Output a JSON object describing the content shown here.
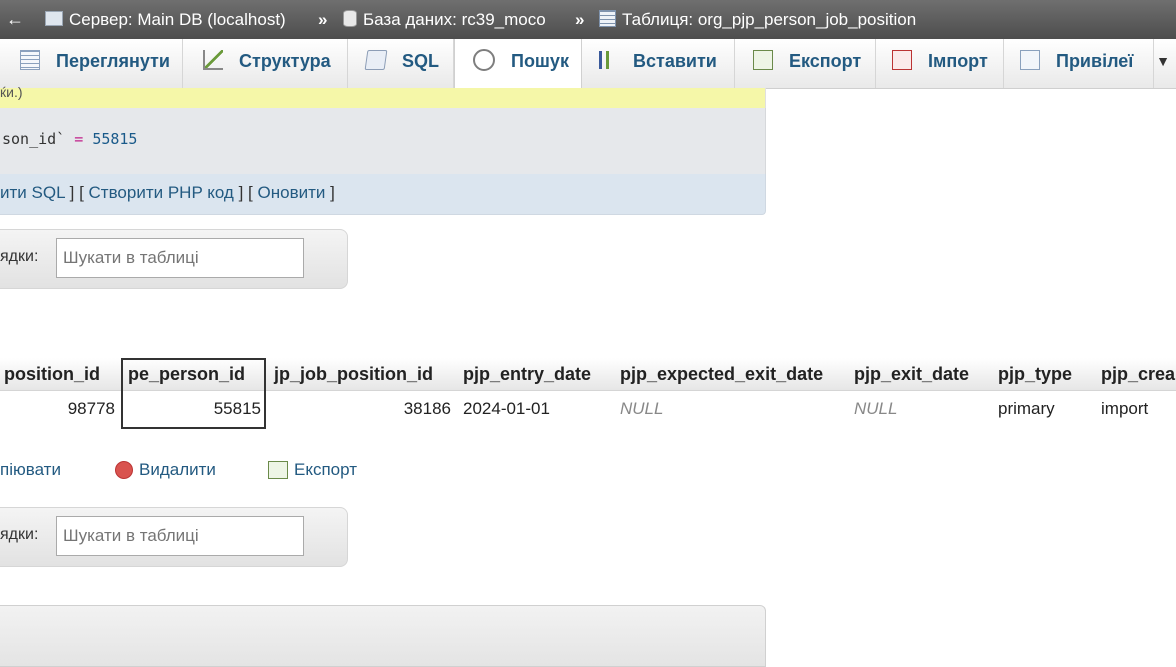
{
  "breadcrumb": {
    "back": "←",
    "server": "Сервер: Main DB (localhost)",
    "database": "База даних: rc39_moco",
    "table": "Таблиця: org_pjp_person_job_position",
    "separator": "»"
  },
  "tabs": [
    {
      "label": "Переглянути",
      "icon": "browse-icon"
    },
    {
      "label": "Структура",
      "icon": "structure-icon"
    },
    {
      "label": "SQL",
      "icon": "sql-icon"
    },
    {
      "label": "Пошук",
      "icon": "search-icon"
    },
    {
      "label": "Вставити",
      "icon": "insert-icon"
    },
    {
      "label": "Експорт",
      "icon": "export-icon"
    },
    {
      "label": "Імпорт",
      "icon": "import-icon"
    },
    {
      "label": "Привілеї",
      "icon": "privileges-icon"
    }
  ],
  "more_caret": "▼",
  "notice_text": "ќи.)",
  "sql": {
    "column": "son_id`",
    "operator": "=",
    "value": "55815"
  },
  "sql_links": {
    "edit": "ити SQL",
    "php": "Створити PHP код",
    "refresh": "Оновити"
  },
  "filter": {
    "label": "ядки:",
    "placeholder": "Шукати в таблиці"
  },
  "table": {
    "columns": [
      "position_id",
      "pe_person_id",
      "jp_job_position_id",
      "pjp_entry_date",
      "pjp_expected_exit_date",
      "pjp_exit_date",
      "pjp_type",
      "pjp_crea"
    ],
    "row": [
      "98778",
      "55815",
      "38186",
      "2024-01-01",
      "NULL",
      "NULL",
      "primary",
      "import"
    ]
  },
  "actions": {
    "copy": "піювати",
    "delete": "Видалити",
    "export": "Експорт"
  },
  "colors": {
    "link": "#235a81",
    "breadcrumb_bg": "#5e5e5e",
    "notice_bg": "#f5f7a8",
    "sql_links_bg": "#dbe5ef"
  }
}
